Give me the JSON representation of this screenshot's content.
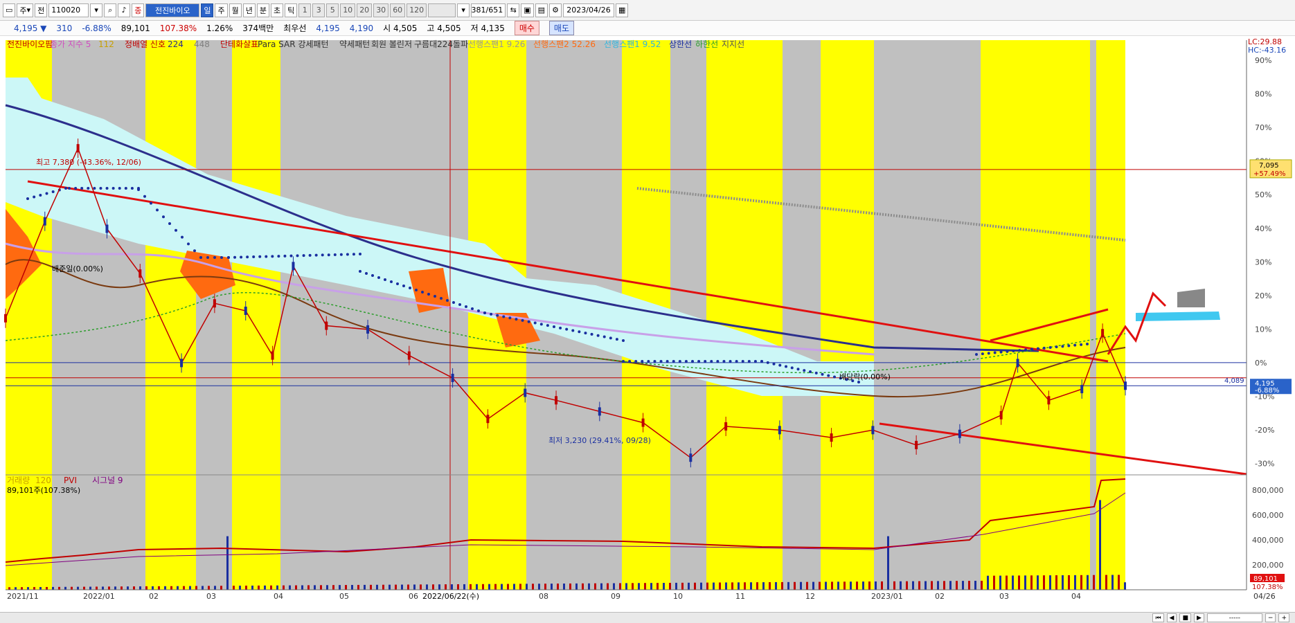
{
  "toolbar": {
    "market": "주",
    "prev": "전",
    "code": "110020",
    "name_badge": "종",
    "name": "전진바이오",
    "periods": [
      "일",
      "주",
      "월",
      "년",
      "분",
      "초",
      "틱"
    ],
    "active_period": "일",
    "intervals": [
      "1",
      "3",
      "5",
      "10",
      "20",
      "30",
      "60",
      "120"
    ],
    "count": "381",
    "count_total": "/651",
    "date": "2023/04/26"
  },
  "quote": {
    "price": "4,195",
    "change": "310",
    "change_pct": "-6.88%",
    "volume": "89,101",
    "volume_ratio": "107.38%",
    "turnover": "1.26%",
    "amount": "374백만",
    "best_label": "최우선",
    "ask": "4,195",
    "bid": "4,190",
    "open_label": "시",
    "open": "4,505",
    "high_label": "고",
    "high": "4,505",
    "low_label": "저",
    "low": "4,135",
    "buy_label": "매수",
    "sell_label": "매도"
  },
  "colors": {
    "yellow_band": "#ffff00",
    "gray_band": "#c0c0c0",
    "trend_red": "#e01010",
    "ma_navy": "#2c2f8c",
    "cloud_light": "#ccf7f7",
    "cloud_orange": "#ff6a10",
    "psar_blue": "#1a2fa0"
  },
  "chart_data": [
    {
      "type": "line",
      "title": "",
      "legend": [
        {
          "label": "전진바이오팜",
          "color": "#c00000"
        },
        {
          "label": "종가 지수 5",
          "color": "#d04fc0"
        },
        {
          "label": "112",
          "color": "#c8a000"
        },
        {
          "label": "정배열 신호",
          "color": "#c00000"
        },
        {
          "label": "224",
          "color": "#2c2f8c"
        },
        {
          "label": "448",
          "color": "#808080"
        },
        {
          "label": "단테화살표",
          "color": "#c00000"
        },
        {
          "label": "Para SAR 강세패턴",
          "color": "#333333"
        },
        {
          "label": "약세패턴",
          "color": "#333333"
        },
        {
          "label": "회원 볼린저",
          "color": "#333333"
        },
        {
          "label": "구름대224돌파",
          "color": "#333333"
        },
        {
          "label": "선행스팬1 9.26",
          "color": "#999999"
        },
        {
          "label": "선행스팬2 52.26",
          "color": "#ff6a10"
        },
        {
          "label": "선행스팬1 9.52",
          "color": "#2fb6e0"
        },
        {
          "label": "상한선",
          "color": "#1a2fa0"
        },
        {
          "label": "하한선",
          "color": "#2a9d2a"
        },
        {
          "label": "지지선",
          "color": "#555555"
        }
      ],
      "y_axis_pct_labels": [
        "90%",
        "80%",
        "70%",
        "60%",
        "50%",
        "40%",
        "30%",
        "20%",
        "10%",
        "0%",
        "-10%",
        "-20%",
        "-30%"
      ],
      "y_pct_range": [
        -33,
        96
      ],
      "x_labels": [
        "2021/11",
        "2022/01",
        "02",
        "03",
        "04",
        "05",
        "06",
        "2022/06/22(수)",
        "08",
        "09",
        "10",
        "11",
        "12",
        "2023/01",
        "02",
        "03",
        "04",
        "04/26"
      ],
      "lc": "LC:29.88",
      "hc": "HC:-43.16",
      "high_annotation": "최고 7,380 (-43.36%, 12/06)",
      "low_annotation": "최저 3,230 (29.41%, 09/28)",
      "base_annotation": "배준일(0.00%)",
      "mid_annotation": "배당락(0.00%)",
      "price_tag_1": "7,095",
      "price_tag_1_pct": "+57.49%",
      "price_tag_2": "4,195",
      "price_tag_2_pct": "-6.88%",
      "level_label": "4,089",
      "price_points": [
        {
          "d": "2021/11/01",
          "p": 5100
        },
        {
          "d": "2021/11/20",
          "p": 6400
        },
        {
          "d": "2021/12/06",
          "p": 7380
        },
        {
          "d": "2021/12/20",
          "p": 6300
        },
        {
          "d": "2022/01/05",
          "p": 5700
        },
        {
          "d": "2022/01/25",
          "p": 4500
        },
        {
          "d": "2022/02/10",
          "p": 5300
        },
        {
          "d": "2022/02/25",
          "p": 5200
        },
        {
          "d": "2022/03/10",
          "p": 4600
        },
        {
          "d": "2022/03/20",
          "p": 5800
        },
        {
          "d": "2022/04/05",
          "p": 5000
        },
        {
          "d": "2022/04/25",
          "p": 4950
        },
        {
          "d": "2022/05/15",
          "p": 4600
        },
        {
          "d": "2022/06/05",
          "p": 4300
        },
        {
          "d": "2022/06/22",
          "p": 3750
        },
        {
          "d": "2022/07/10",
          "p": 4100
        },
        {
          "d": "2022/07/25",
          "p": 4000
        },
        {
          "d": "2022/08/15",
          "p": 3850
        },
        {
          "d": "2022/09/05",
          "p": 3700
        },
        {
          "d": "2022/09/28",
          "p": 3230
        },
        {
          "d": "2022/10/15",
          "p": 3650
        },
        {
          "d": "2022/11/10",
          "p": 3600
        },
        {
          "d": "2022/12/05",
          "p": 3500
        },
        {
          "d": "2022/12/25",
          "p": 3600
        },
        {
          "d": "2023/01/15",
          "p": 3400
        },
        {
          "d": "2023/02/05",
          "p": 3550
        },
        {
          "d": "2023/02/25",
          "p": 3800
        },
        {
          "d": "2023/03/05",
          "p": 4500
        },
        {
          "d": "2023/03/20",
          "p": 4000
        },
        {
          "d": "2023/04/05",
          "p": 4150
        },
        {
          "d": "2023/04/15",
          "p": 4900
        },
        {
          "d": "2023/04/26",
          "p": 4195
        }
      ]
    },
    {
      "type": "bar",
      "legend": [
        {
          "label": "거래량",
          "color": "#c8a000"
        },
        {
          "label": "120",
          "color": "#c8a000"
        },
        {
          "label": "PVI",
          "color": "#c00000"
        },
        {
          "label": "시그널 9",
          "color": "#800080"
        }
      ],
      "volume_label": "89,101주(107.38%)",
      "y_ticks": [
        200000,
        400000,
        600000,
        800000
      ],
      "y_tick_labels": [
        "200,000",
        "400,000",
        "600,000",
        "800,000"
      ],
      "ylim": [
        0,
        900000
      ],
      "last_volume": "89,101",
      "last_volume_pct": "107.38%"
    }
  ]
}
